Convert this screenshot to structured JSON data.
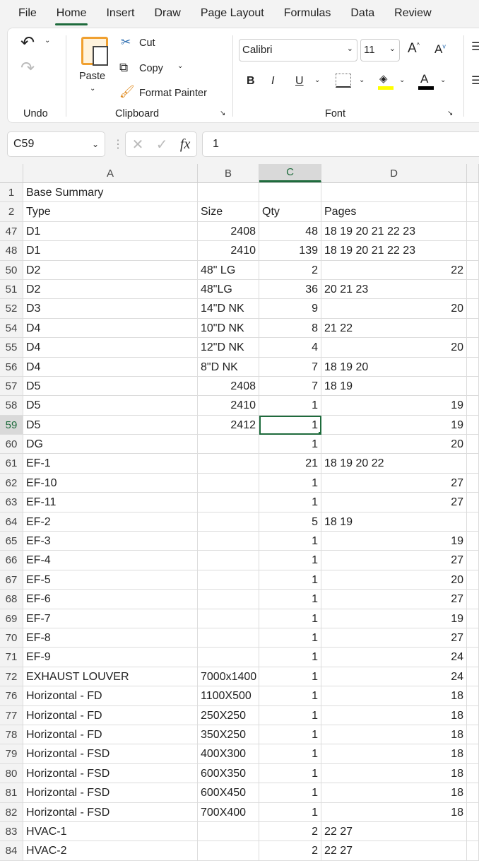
{
  "tabs": [
    "File",
    "Home",
    "Insert",
    "Draw",
    "Page Layout",
    "Formulas",
    "Data",
    "Review"
  ],
  "active_tab": "Home",
  "ribbon": {
    "undo_group": "Undo",
    "paste": "Paste",
    "cut": "Cut",
    "copy": "Copy",
    "format_painter": "Format Painter",
    "clipboard_group": "Clipboard",
    "font_name": "Calibri",
    "font_size": "11",
    "bold": "B",
    "italic": "I",
    "underline": "U",
    "font_color_glyph": "A",
    "grow": "A",
    "shrink": "A",
    "font_group": "Font"
  },
  "colors": {
    "accent": "#1e6b3c",
    "highlight": "#ffff00",
    "font_color": "#000000"
  },
  "formula_bar": {
    "name_box": "C59",
    "fx": "fx",
    "value": "1"
  },
  "columns": [
    "A",
    "B",
    "C",
    "D"
  ],
  "selected_column": "C",
  "rows": [
    {
      "n": "1",
      "a": "Base Summary",
      "b": "",
      "c": "",
      "d": ""
    },
    {
      "n": "2",
      "a": "Type",
      "b": "Size",
      "c": "Qty",
      "d": "Pages"
    },
    {
      "n": "47",
      "a": "D1",
      "b": "2408",
      "c": "48",
      "d": "18  19  20  21  22  23"
    },
    {
      "n": "48",
      "a": "D1",
      "b": "2410",
      "c": "139",
      "d": "18  19  20  21  22  23"
    },
    {
      "n": "50",
      "a": "D2",
      "b": "48\" LG",
      "c": "2",
      "d": "22"
    },
    {
      "n": "51",
      "a": "D2",
      "b": "48\"LG",
      "c": "36",
      "d": "20  21  23"
    },
    {
      "n": "52",
      "a": "D3",
      "b": "14\"D NK",
      "c": "9",
      "d": "20"
    },
    {
      "n": "54",
      "a": "D4",
      "b": "10\"D NK",
      "c": "8",
      "d": "21  22"
    },
    {
      "n": "55",
      "a": "D4",
      "b": "12\"D NK",
      "c": "4",
      "d": "20"
    },
    {
      "n": "56",
      "a": "D4",
      "b": "8\"D NK",
      "c": "7",
      "d": "18  19  20"
    },
    {
      "n": "57",
      "a": "D5",
      "b": "2408",
      "c": "7",
      "d": "18  19"
    },
    {
      "n": "58",
      "a": "D5",
      "b": "2410",
      "c": "1",
      "d": "19"
    },
    {
      "n": "59",
      "a": "D5",
      "b": "2412",
      "c": "1",
      "d": "19"
    },
    {
      "n": "60",
      "a": "DG",
      "b": "",
      "c": "1",
      "d": "20"
    },
    {
      "n": "61",
      "a": "EF-1",
      "b": "",
      "c": "21",
      "d": "18  19  20  22"
    },
    {
      "n": "62",
      "a": "EF-10",
      "b": "",
      "c": "1",
      "d": "27"
    },
    {
      "n": "63",
      "a": "EF-11",
      "b": "",
      "c": "1",
      "d": "27"
    },
    {
      "n": "64",
      "a": "EF-2",
      "b": "",
      "c": "5",
      "d": "18  19"
    },
    {
      "n": "65",
      "a": "EF-3",
      "b": "",
      "c": "1",
      "d": "19"
    },
    {
      "n": "66",
      "a": "EF-4",
      "b": "",
      "c": "1",
      "d": "27"
    },
    {
      "n": "67",
      "a": "EF-5",
      "b": "",
      "c": "1",
      "d": "20"
    },
    {
      "n": "68",
      "a": "EF-6",
      "b": "",
      "c": "1",
      "d": "27"
    },
    {
      "n": "69",
      "a": "EF-7",
      "b": "",
      "c": "1",
      "d": "19"
    },
    {
      "n": "70",
      "a": "EF-8",
      "b": "",
      "c": "1",
      "d": "27"
    },
    {
      "n": "71",
      "a": "EF-9",
      "b": "",
      "c": "1",
      "d": "24"
    },
    {
      "n": "72",
      "a": "EXHAUST LOUVER",
      "b": "7000x1400",
      "c": "1",
      "d": "24"
    },
    {
      "n": "76",
      "a": "Horizontal - FD",
      "b": "1100X500",
      "c": "1",
      "d": "18"
    },
    {
      "n": "77",
      "a": "Horizontal - FD",
      "b": "250X250",
      "c": "1",
      "d": "18"
    },
    {
      "n": "78",
      "a": "Horizontal - FD",
      "b": "350X250",
      "c": "1",
      "d": "18"
    },
    {
      "n": "79",
      "a": "Horizontal - FSD",
      "b": "400X300",
      "c": "1",
      "d": "18"
    },
    {
      "n": "80",
      "a": "Horizontal - FSD",
      "b": "600X350",
      "c": "1",
      "d": "18"
    },
    {
      "n": "81",
      "a": "Horizontal - FSD",
      "b": "600X450",
      "c": "1",
      "d": "18"
    },
    {
      "n": "82",
      "a": "Horizontal - FSD",
      "b": "700X400",
      "c": "1",
      "d": "18"
    },
    {
      "n": "83",
      "a": "HVAC-1",
      "b": "",
      "c": "2",
      "d": "22  27"
    },
    {
      "n": "84",
      "a": "HVAC-2",
      "b": "",
      "c": "2",
      "d": "22  27"
    }
  ]
}
